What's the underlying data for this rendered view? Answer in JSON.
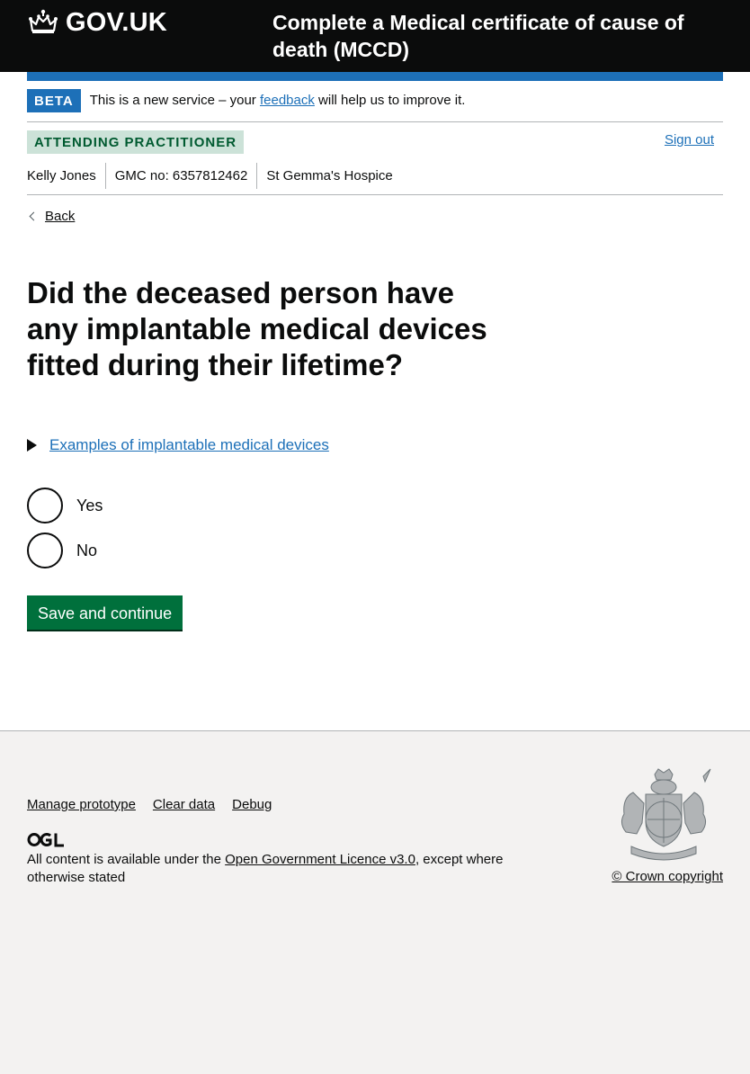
{
  "header": {
    "logo_text": "GOV.UK",
    "service_name": "Complete a Medical certificate of cause of death (MCCD)"
  },
  "phase_banner": {
    "tag": "BETA",
    "text_before": "This is a new service – your ",
    "link": "feedback",
    "text_after": " will help us to improve it."
  },
  "practitioner": {
    "role": "ATTENDING PRACTITIONER",
    "sign_out": "Sign out",
    "name": "Kelly Jones",
    "gmc": "GMC no: 6357812462",
    "organisation": "St Gemma's Hospice"
  },
  "nav": {
    "back": "Back"
  },
  "question": {
    "heading": "Did the deceased person have any implantable medical devices fitted during their lifetime?",
    "details_summary": "Examples of implantable medical devices",
    "options": [
      {
        "label": "Yes",
        "selected": false
      },
      {
        "label": "No",
        "selected": false
      }
    ],
    "submit": "Save and continue"
  },
  "footer": {
    "links": [
      "Manage prototype",
      "Clear data",
      "Debug"
    ],
    "licence_before": "All content is available under the ",
    "licence_link": "Open Government Licence v3.0",
    "licence_after": ", except where otherwise stated",
    "copyright": "© Crown copyright"
  },
  "colors": {
    "header_bg": "#0b0c0c",
    "brand_blue": "#1d70b8",
    "button_green": "#00703c",
    "tag_green_bg": "#cce2d8",
    "tag_green_text": "#005a30",
    "footer_bg": "#f3f2f1"
  }
}
